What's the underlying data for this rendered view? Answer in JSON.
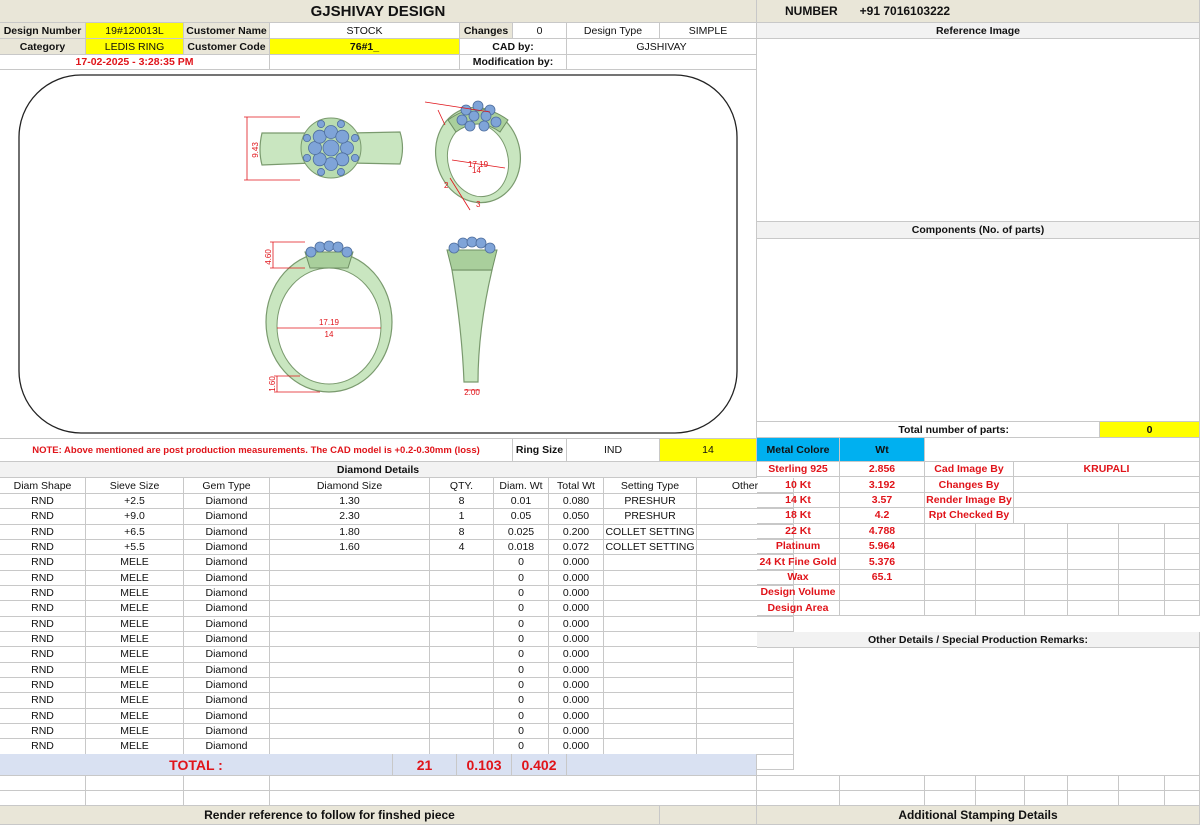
{
  "header": {
    "title": "GJSHIVAY DESIGN",
    "number_label": "NUMBER",
    "number_value": "+91 7016103222"
  },
  "info": {
    "design_number_label": "Design Number",
    "design_number": "19#120013L",
    "customer_name_label": "Customer Name",
    "customer_name": "STOCK",
    "changes_label": "Changes",
    "changes": "0",
    "design_type_label": "Design Type",
    "design_type": "SIMPLE",
    "category_label": "Category",
    "category": "LEDIS RING",
    "customer_code_label": "Customer Code",
    "customer_code": "76#1_",
    "cad_by_label": "CAD by:",
    "cad_by": "GJSHIVAY",
    "date": "17-02-2025 - 3:28:35 PM",
    "modification_label": "Modification by:"
  },
  "dimensions": {
    "top_height": "9.43",
    "persp_a": "17.19",
    "persp_b": "14",
    "persp_c": "2",
    "persp_d": "3",
    "front_head": "4.60",
    "front_diam": "17.19",
    "front_size": "14",
    "front_shank": "1.60",
    "side_width": "2.00"
  },
  "note": {
    "text": "NOTE: Above mentioned are post production measurements. The CAD model is +0.2-0.30mm (loss)",
    "ring_size_label": "Ring Size",
    "ring_size_std": "IND",
    "ring_size": "14"
  },
  "right_panel": {
    "reference_image": "Reference Image",
    "components": "Components (No. of parts)",
    "total_parts_label": "Total number of parts:",
    "total_parts": "0",
    "metal_label": "Metal Colore",
    "wt_label": "Wt",
    "other_details": "Other Details / Special Production Remarks:",
    "stamping": "Additional Stamping Details"
  },
  "metals": [
    {
      "name": "Sterling 925",
      "wt": "2.856"
    },
    {
      "name": "10 Kt",
      "wt": "3.192"
    },
    {
      "name": "14 Kt",
      "wt": "3.57"
    },
    {
      "name": "18 Kt",
      "wt": "4.2"
    },
    {
      "name": "22 Kt",
      "wt": "4.788"
    },
    {
      "name": "Platinum",
      "wt": "5.964"
    },
    {
      "name": "24 Kt Fine Gold",
      "wt": "5.376"
    },
    {
      "name": "Wax",
      "wt": "65.1"
    },
    {
      "name": "Design Volume",
      "wt": ""
    },
    {
      "name": "Design Area",
      "wt": ""
    }
  ],
  "credits": [
    {
      "label": "Cad Image By",
      "value": "KRUPALI"
    },
    {
      "label": "Changes By",
      "value": ""
    },
    {
      "label": "Render Image By",
      "value": ""
    },
    {
      "label": "Rpt Checked By",
      "value": ""
    }
  ],
  "diamond": {
    "title": "Diamond Details",
    "headers": [
      "Diam Shape",
      "Sieve Size",
      "Gem Type",
      "Diamond Size",
      "QTY.",
      "Diam. Wt",
      "Total Wt",
      "Setting Type",
      "Other"
    ],
    "rows": [
      [
        "RND",
        "+2.5",
        "Diamond",
        "1.30",
        "8",
        "0.01",
        "0.080",
        "PRESHUR",
        ""
      ],
      [
        "RND",
        "+9.0",
        "Diamond",
        "2.30",
        "1",
        "0.05",
        "0.050",
        "PRESHUR",
        ""
      ],
      [
        "RND",
        "+6.5",
        "Diamond",
        "1.80",
        "8",
        "0.025",
        "0.200",
        "COLLET SETTING",
        ""
      ],
      [
        "RND",
        "+5.5",
        "Diamond",
        "1.60",
        "4",
        "0.018",
        "0.072",
        "COLLET SETTING",
        ""
      ],
      [
        "RND",
        "MELE",
        "Diamond",
        "",
        "",
        "0",
        "0.000",
        "",
        ""
      ],
      [
        "RND",
        "MELE",
        "Diamond",
        "",
        "",
        "0",
        "0.000",
        "",
        ""
      ],
      [
        "RND",
        "MELE",
        "Diamond",
        "",
        "",
        "0",
        "0.000",
        "",
        ""
      ],
      [
        "RND",
        "MELE",
        "Diamond",
        "",
        "",
        "0",
        "0.000",
        "",
        ""
      ],
      [
        "RND",
        "MELE",
        "Diamond",
        "",
        "",
        "0",
        "0.000",
        "",
        ""
      ],
      [
        "RND",
        "MELE",
        "Diamond",
        "",
        "",
        "0",
        "0.000",
        "",
        ""
      ],
      [
        "RND",
        "MELE",
        "Diamond",
        "",
        "",
        "0",
        "0.000",
        "",
        ""
      ],
      [
        "RND",
        "MELE",
        "Diamond",
        "",
        "",
        "0",
        "0.000",
        "",
        ""
      ],
      [
        "RND",
        "MELE",
        "Diamond",
        "",
        "",
        "0",
        "0.000",
        "",
        ""
      ],
      [
        "RND",
        "MELE",
        "Diamond",
        "",
        "",
        "0",
        "0.000",
        "",
        ""
      ],
      [
        "RND",
        "MELE",
        "Diamond",
        "",
        "",
        "0",
        "0.000",
        "",
        ""
      ],
      [
        "RND",
        "MELE",
        "Diamond",
        "",
        "",
        "0",
        "0.000",
        "",
        ""
      ],
      [
        "RND",
        "MELE",
        "Diamond",
        "",
        "",
        "0",
        "0.000",
        "",
        ""
      ],
      [
        "RND",
        "MELE",
        "Diamond",
        "",
        "",
        "0",
        "0.000",
        "",
        ""
      ]
    ],
    "total_label": "TOTAL :",
    "total_qty": "21",
    "total_diam_wt": "0.103",
    "total_wt": "0.402"
  },
  "footer": {
    "render_note": "Render reference to follow for finshed piece"
  }
}
